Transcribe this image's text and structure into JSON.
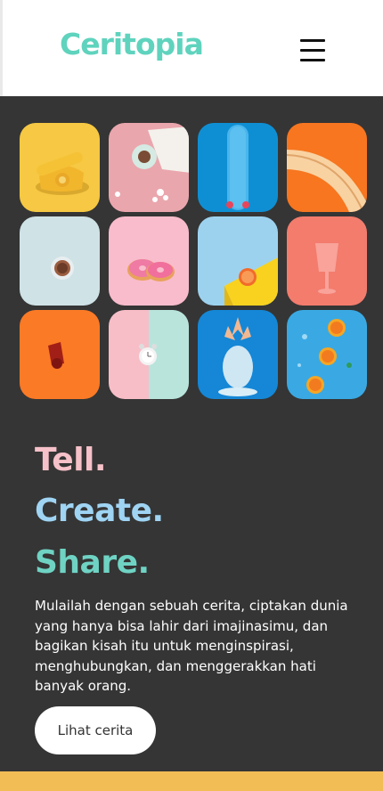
{
  "header": {
    "logo": "Ceritopia",
    "menu_icon": "hamburger-menu-icon"
  },
  "gallery": {
    "tiles": [
      {
        "name": "yellow-rotary-phone",
        "bg": "#f6c843"
      },
      {
        "name": "coffee-cup-and-sweater",
        "bg": "#eaa6ad"
      },
      {
        "name": "blue-skateboard",
        "bg": "#0f8fd3"
      },
      {
        "name": "orange-plate",
        "bg": "#f7761f"
      },
      {
        "name": "espresso-cup",
        "bg": "#cfe2e6"
      },
      {
        "name": "pink-donuts",
        "bg": "#f9bccc"
      },
      {
        "name": "orange-slice-on-yellow-block",
        "bg": "#9dd2ef"
      },
      {
        "name": "pink-glass",
        "bg": "#f37c6d"
      },
      {
        "name": "orange-object",
        "bg": "#fb7a26"
      },
      {
        "name": "alarm-clock",
        "bg": "#f7bec7"
      },
      {
        "name": "painted-pineapple",
        "bg": "#1587d6"
      },
      {
        "name": "orange-slices-in-water",
        "bg": "#3aa9e3"
      }
    ]
  },
  "hero": {
    "tell": "Tell.",
    "create": "Create.",
    "share": "Share.",
    "description": "Mulailah dengan sebuah cerita, ciptakan dunia yang hanya bisa lahir dari imajinasimu, dan bagikan kisah itu untuk menginspirasi, menghubungkan, dan menggerakkan hati banyak orang.",
    "cta_label": "Lihat cerita"
  },
  "colors": {
    "brand": "#5fd3bd",
    "hero_bg": "#353535",
    "tell": "#f6c1c9",
    "create": "#9fd4f3",
    "share": "#6fd3c4",
    "footer_accent": "#f2bd55"
  }
}
